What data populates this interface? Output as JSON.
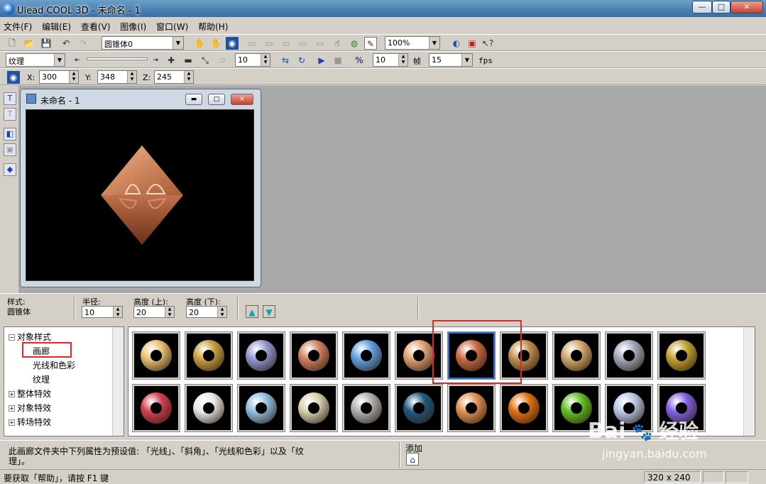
{
  "window": {
    "title": "Ulead COOL 3D - 未命名 - 1",
    "min": "—",
    "max": "□",
    "close": "✕"
  },
  "menu": [
    "文件(F)",
    "编辑(E)",
    "查看(V)",
    "图像(I)",
    "窗口(W)",
    "帮助(H)"
  ],
  "toolbar1": {
    "object_select": "圆锥体0",
    "zoom": "100%"
  },
  "toolbar2": {
    "attribute_select": "纹理",
    "frame_value": "10",
    "step_value": "10",
    "frame_label": "帧",
    "fps_value": "15",
    "fps_label": "fps"
  },
  "toolbar3": {
    "x_label": "X:",
    "x_value": "300",
    "y_label": "Y:",
    "y_value": "348",
    "z_label": "Z:",
    "z_value": "245"
  },
  "document": {
    "title": "未命名 - 1"
  },
  "properties": {
    "style_label": "样式:",
    "style_value": "圆锥体",
    "radius_label": "半径:",
    "radius_value": "10",
    "height_top_label": "高度 (上):",
    "height_top_value": "20",
    "height_bottom_label": "高度 (下):",
    "height_bottom_value": "20"
  },
  "tree": {
    "root": "对象样式",
    "children": [
      "画廊",
      "光线和色彩",
      "纹理"
    ],
    "others": [
      "整体特效",
      "对象特效",
      "转场特效"
    ]
  },
  "gallery": {
    "row1": [
      "#e8c070",
      "#c8a040",
      "#9098d0",
      "#d08060",
      "#60a0e0",
      "#e0a070",
      "#c86a40",
      "#c09050",
      "#d0a868",
      "#a0a8b8",
      "#c0a030"
    ],
    "row2": [
      "#d04050",
      "#e8e8e8",
      "#90c0e0",
      "#d8d0b0",
      "#b0b0b0",
      "#205880",
      "#e09050",
      "#e07010",
      "#60c020",
      "#b8c8e8",
      "#8060e0"
    ]
  },
  "hint": {
    "text_line1": "此画廊文件夹中下列属性为预设值: 「光线」、「斜角」、「光线和色彩」以及「纹",
    "text_line2": "理」。",
    "add_label": "添加"
  },
  "status": {
    "help_text": "要获取「帮助」，请按 F1 键",
    "size": "320 x 240"
  },
  "watermark": {
    "brand": "Bai",
    "brand2": "经验",
    "url": "jingyan.baidu.com"
  }
}
